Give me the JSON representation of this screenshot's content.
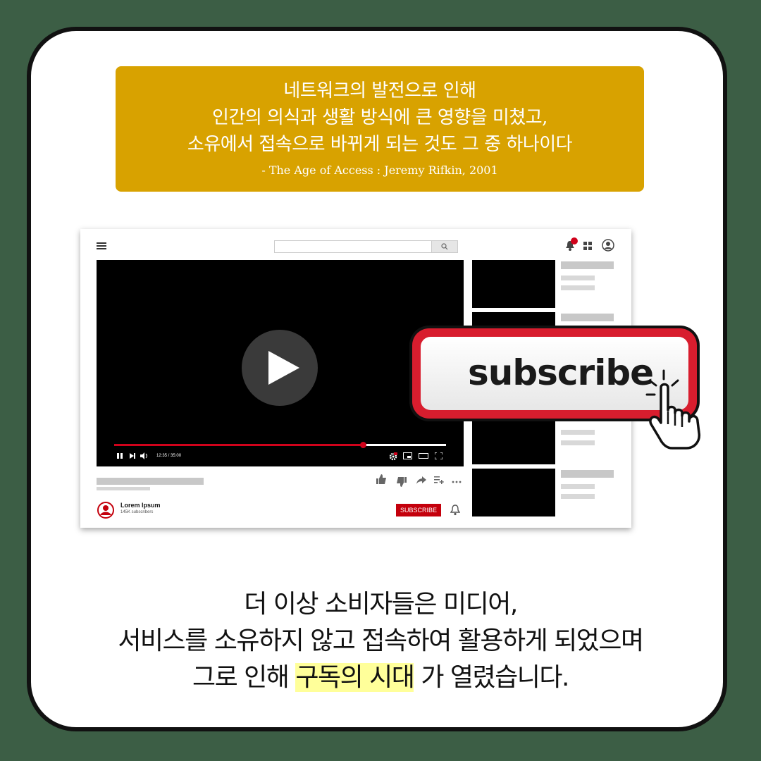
{
  "quote": {
    "lines": [
      "네트워크의 발전으로 인해",
      "인간의 의식과 생활 방식에 큰 영향을 미쳤고,",
      "소유에서 접속으로 바뀌게 되는 것도 그 중 하나이다"
    ],
    "source": "- The Age of Access : Jeremy Rifkin, 2001"
  },
  "player": {
    "time": "12:35 / 35:00",
    "progress_fraction": 0.75
  },
  "channel": {
    "name": "Lorem Ipsum",
    "subscribers": "145K subscribers",
    "subscribe_label": "SUBSCRIBE"
  },
  "big_button": {
    "label": "subscribe"
  },
  "bottom": {
    "line1": "더 이상 소비자들은 미디어,",
    "line2": "서비스를 소유하지 않고 접속하여 활용하게 되었으며",
    "line3_before": "그로 인해 ",
    "line3_highlight": "구독의 시대",
    "line3_after": " 가 열렸습니다."
  },
  "colors": {
    "background": "#3c5e45",
    "quote_box": "#d8a200",
    "accent_red": "#d0021b",
    "highlight": "#ffff9a"
  }
}
